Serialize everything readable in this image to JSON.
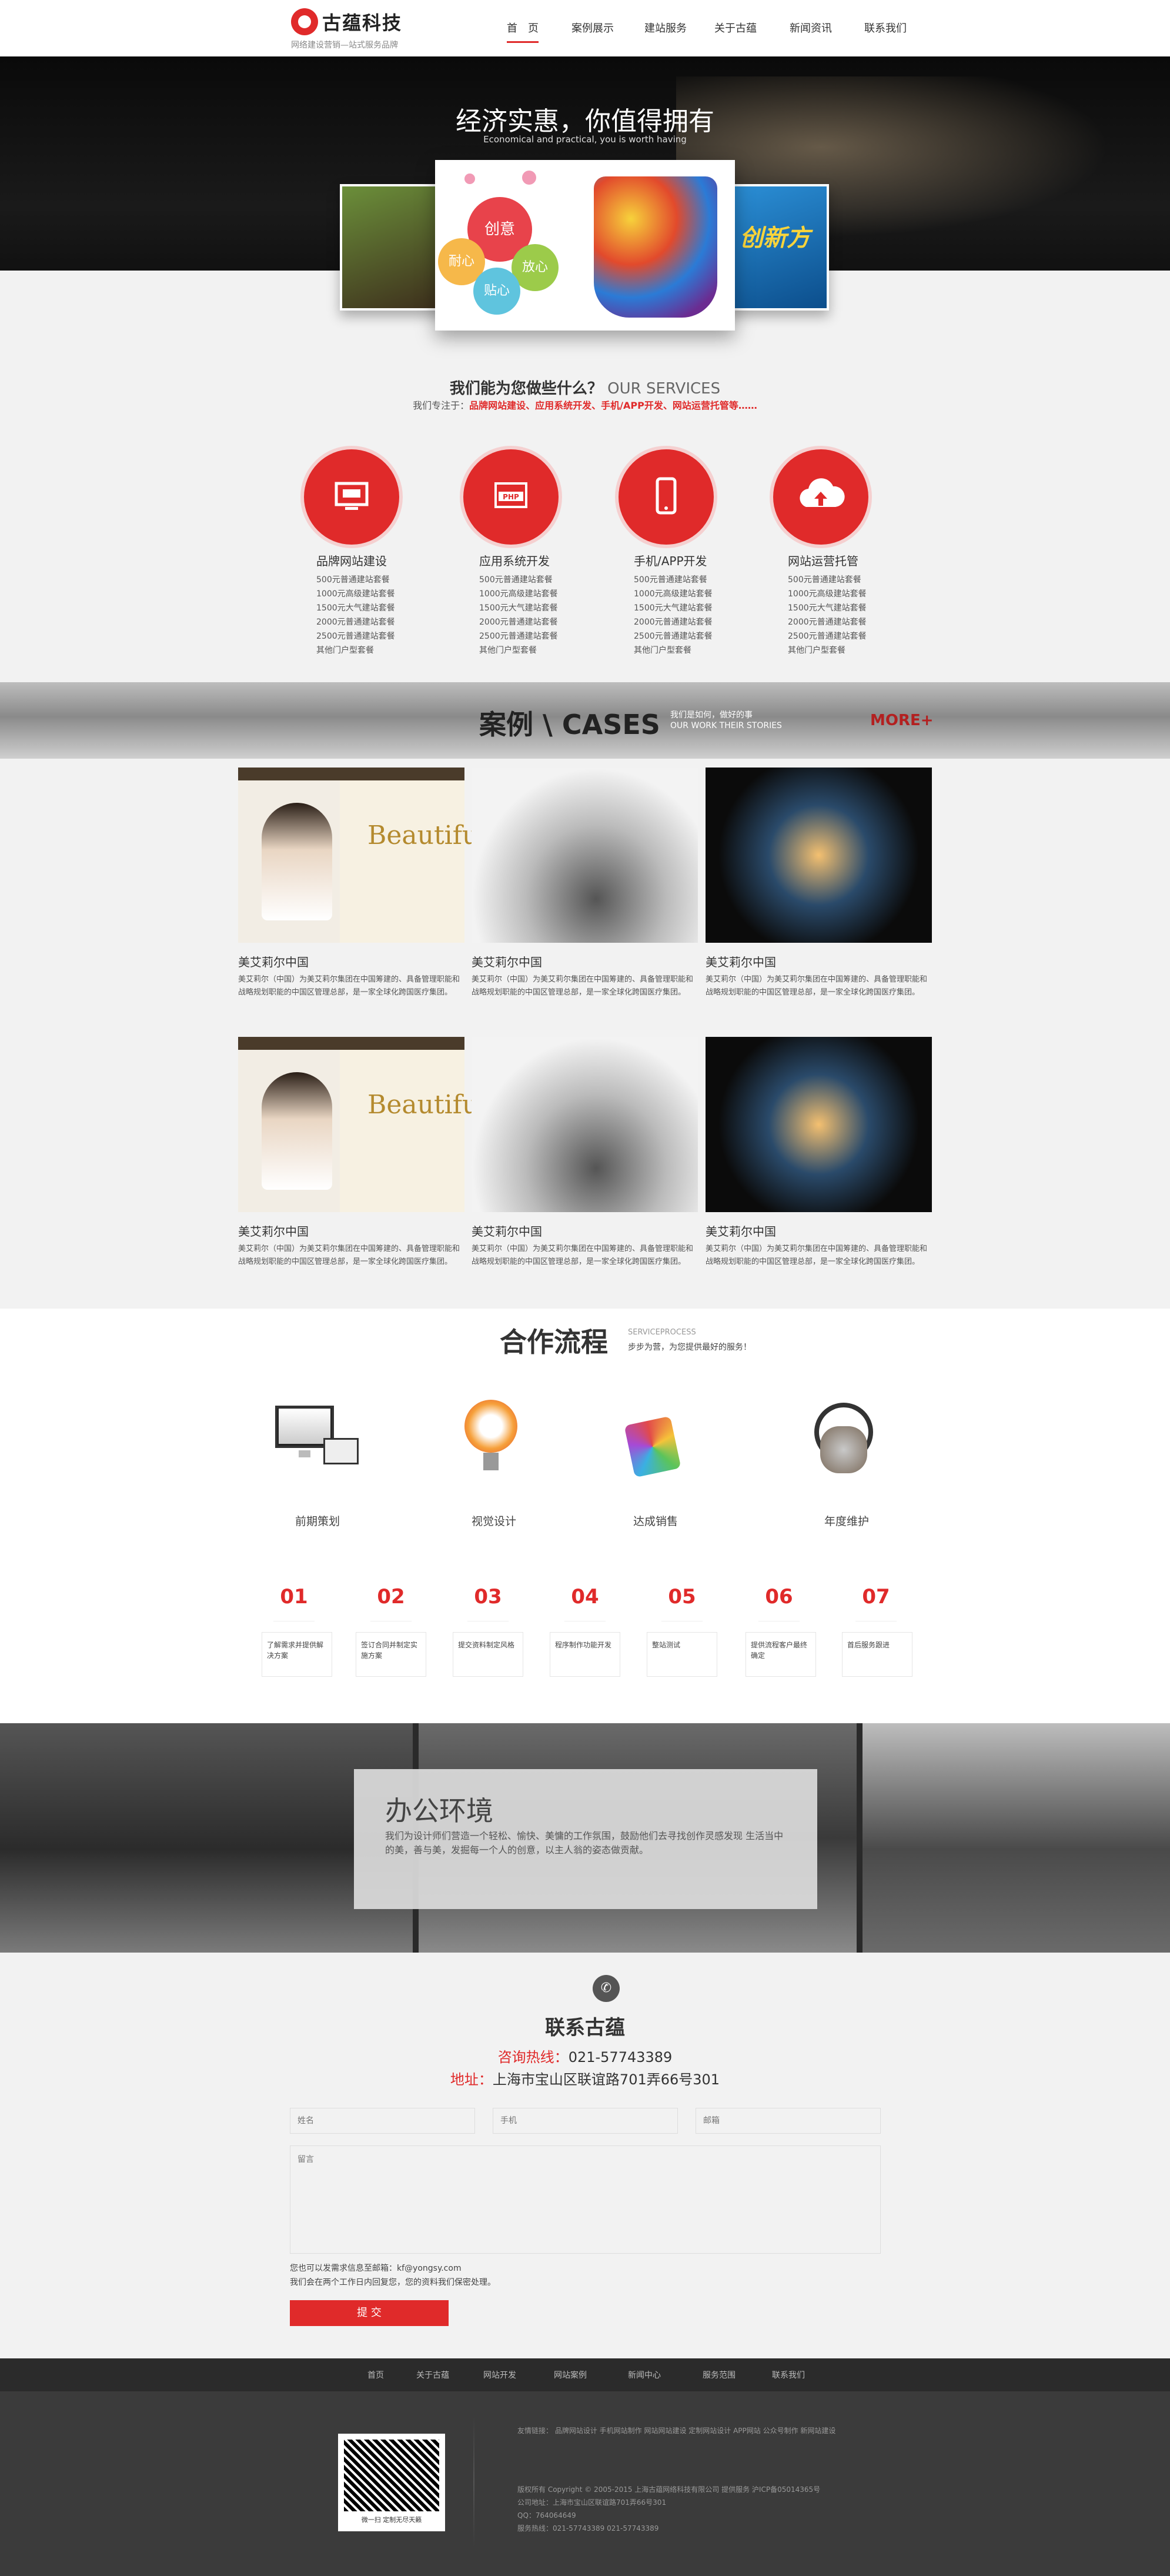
{
  "header": {
    "logo_name": "古蕴科技",
    "logo_slogan": "网络建设营销—站式服务品牌",
    "nav": [
      "首　页",
      "案例展示",
      "建站服务",
      "关于古蕴",
      "新闻资讯",
      "联系我们"
    ]
  },
  "banner": {
    "title": "经济实惠，你值得拥有",
    "subtitle": "Economical and practical, you is worth having",
    "bubbles": [
      "创意",
      "耐心",
      "放心",
      "贴心"
    ],
    "right_card_text": "创新方"
  },
  "services": {
    "title_cn": "我们能为您做些什么？",
    "title_en": "OUR SERVICES",
    "intro_prefix": "我们专注于：",
    "intro_items": "品牌网站建设、应用系统开发、手机/APP开发、网站运营托管等……",
    "items": [
      {
        "icon": "monitor-icon",
        "name": "品牌网站建设",
        "list": [
          "500元普通建站套餐",
          "1000元高级建站套餐",
          "1500元大气建站套餐",
          "2000元普通建站套餐",
          "2500元普通建站套餐",
          "其他门户型套餐"
        ]
      },
      {
        "icon": "php-icon",
        "name": "应用系统开发",
        "list": [
          "500元普通建站套餐",
          "1000元高级建站套餐",
          "1500元大气建站套餐",
          "2000元普通建站套餐",
          "2500元普通建站套餐",
          "其他门户型套餐"
        ]
      },
      {
        "icon": "mobile-icon",
        "name": "手机/APP开发",
        "list": [
          "500元普通建站套餐",
          "1000元高级建站套餐",
          "1500元大气建站套餐",
          "2000元普通建站套餐",
          "2500元普通建站套餐",
          "其他门户型套餐"
        ]
      },
      {
        "icon": "cloud-upload-icon",
        "name": "网站运营托管",
        "list": [
          "500元普通建站套餐",
          "1000元高级建站套餐",
          "1500元大气建站套餐",
          "2000元普通建站套餐",
          "2500元普通建站套餐",
          "其他门户型套餐"
        ]
      }
    ]
  },
  "cases": {
    "title": "案例 \\ CASES",
    "slogan_cn": "我们是如何，做好的事",
    "slogan_en": "OUR WORK THEIR STORIES",
    "more": "MORE+",
    "thumb_text": "Beautiful",
    "items": [
      {
        "title": "美艾莉尔中国",
        "desc": "美艾莉尔（中国）为美艾莉尔集团在中国筹建的、具备管理职能和战略规划职能的中国区管理总部，是一家全球化跨国医疗集团。"
      },
      {
        "title": "美艾莉尔中国",
        "desc": "美艾莉尔（中国）为美艾莉尔集团在中国筹建的、具备管理职能和战略规划职能的中国区管理总部，是一家全球化跨国医疗集团。"
      },
      {
        "title": "美艾莉尔中国",
        "desc": "美艾莉尔（中国）为美艾莉尔集团在中国筹建的、具备管理职能和战略规划职能的中国区管理总部，是一家全球化跨国医疗集团。"
      },
      {
        "title": "美艾莉尔中国",
        "desc": "美艾莉尔（中国）为美艾莉尔集团在中国筹建的、具备管理职能和战略规划职能的中国区管理总部，是一家全球化跨国医疗集团。"
      },
      {
        "title": "美艾莉尔中国",
        "desc": "美艾莉尔（中国）为美艾莉尔集团在中国筹建的、具备管理职能和战略规划职能的中国区管理总部，是一家全球化跨国医疗集团。"
      },
      {
        "title": "美艾莉尔中国",
        "desc": "美艾莉尔（中国）为美艾莉尔集团在中国筹建的、具备管理职能和战略规划职能的中国区管理总部，是一家全球化跨国医疗集团。"
      }
    ]
  },
  "process": {
    "title": "合作流程",
    "sub_en": "SERVICEPROCESS",
    "sub_cn": "步步为营，为您提供最好的服务！",
    "phases": [
      "前期策划",
      "视觉设计",
      "达成销售",
      "年度维护"
    ],
    "steps": [
      {
        "num": "01",
        "text": "了解需求并提供解决方案"
      },
      {
        "num": "02",
        "text": "签订合同并制定实施方案"
      },
      {
        "num": "03",
        "text": "提交资料制定风格"
      },
      {
        "num": "04",
        "text": "程序制作功能开发"
      },
      {
        "num": "05",
        "text": "整站测试"
      },
      {
        "num": "06",
        "text": "提供流程客户最终确定"
      },
      {
        "num": "07",
        "text": "首后服务跟进"
      }
    ]
  },
  "office": {
    "title": "办公环境",
    "text": "我们为设计师们营造一个轻松、愉快、美慵的工作氛围，鼓励他们去寻找创作灵感发现 生活当中的美，善与美，发掘每一个人的创意，以主人翁的姿态做贡献。"
  },
  "contact": {
    "title": "联系古蕴",
    "hotline_label": "咨询热线：",
    "hotline": "021-57743389",
    "address_label": "地址：",
    "address": "上海市宝山区联谊路701弄66号301",
    "name_ph": "姓名",
    "phone_ph": "手机",
    "email_ph": "邮箱",
    "message_ph": "留言",
    "note1": "您也可以发需求信息至邮箱：kf@yongsy.com",
    "note2": "我们会在两个工作日内回复您，您的资料我们保密处理。",
    "submit": "提 交"
  },
  "footer": {
    "nav": [
      "首页",
      "关于古蕴",
      "网站开发",
      "网站案例",
      "新闻中心",
      "服务范围",
      "联系我们"
    ],
    "qr_caption": "微一扫  定制无尽天籁",
    "links": "友情链接：  品牌网站设计  手机网站制作  网站网站建设  定制网站设计  APP网站  公众号制作  新网站建设",
    "copyright": "版权所有  Copyright © 2005-2015  上海古蕴网络科技有限公司  提供服务  沪ICP备05014365号",
    "address": "公司地址：上海市宝山区联谊路701弄66号301",
    "qq": "QQ：764064649",
    "tel": "服务热线：021-57743389        021-57743389"
  }
}
